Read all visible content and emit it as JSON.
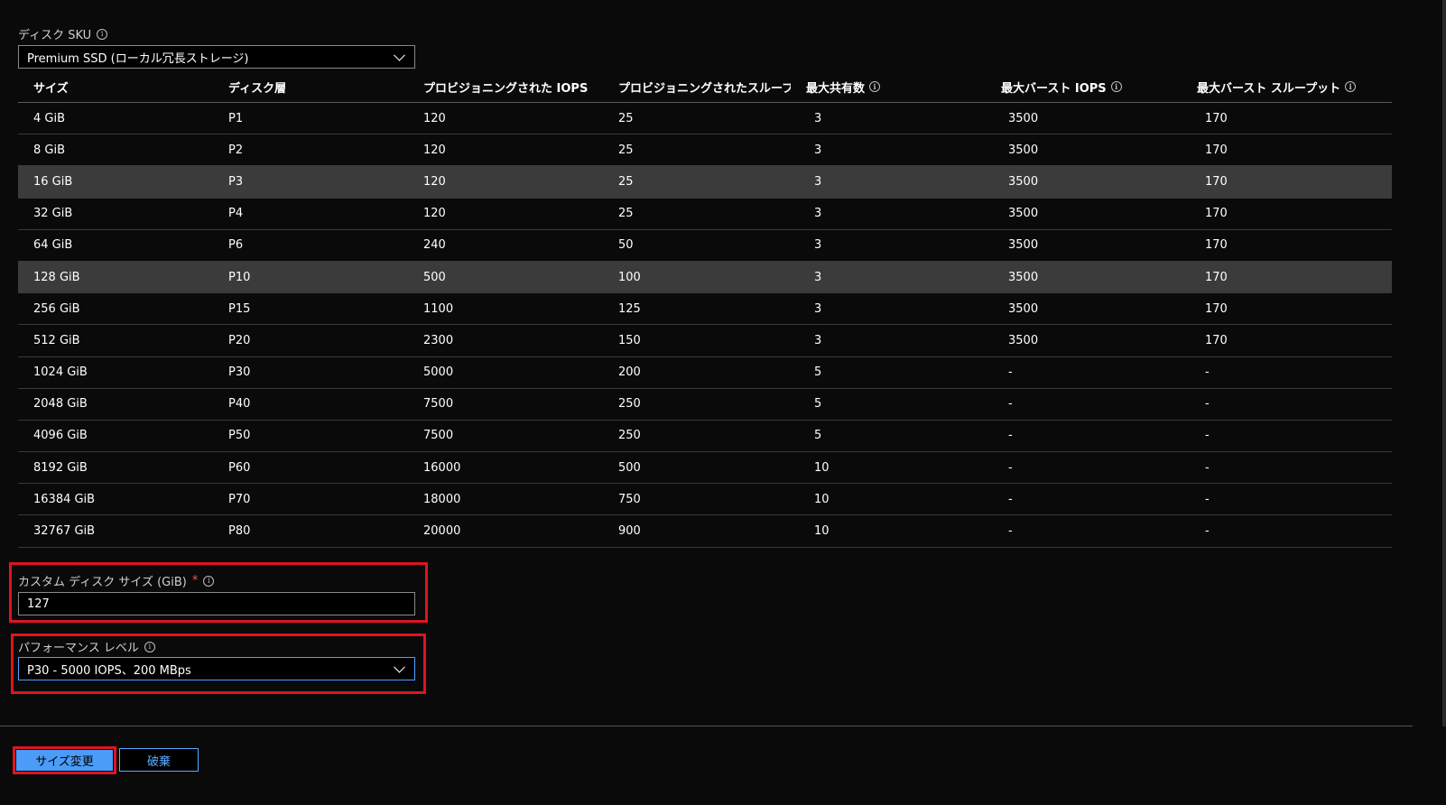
{
  "disk_sku": {
    "label": "ディスク SKU",
    "value": "Premium SSD (ローカル冗長ストレージ)",
    "icon": "info-icon"
  },
  "table": {
    "columns": [
      "サイズ",
      "ディスク層",
      "プロビジョニングされた IOPS",
      "プロビジョニングされたスループ...",
      "最大共有数",
      "最大バースト IOPS",
      "最大バースト スループット"
    ],
    "rows": [
      [
        "4 GiB",
        "P1",
        "120",
        "25",
        "3",
        "3500",
        "170"
      ],
      [
        "8 GiB",
        "P2",
        "120",
        "25",
        "3",
        "3500",
        "170"
      ],
      [
        "16 GiB",
        "P3",
        "120",
        "25",
        "3",
        "3500",
        "170"
      ],
      [
        "32 GiB",
        "P4",
        "120",
        "25",
        "3",
        "3500",
        "170"
      ],
      [
        "64 GiB",
        "P6",
        "240",
        "50",
        "3",
        "3500",
        "170"
      ],
      [
        "128 GiB",
        "P10",
        "500",
        "100",
        "3",
        "3500",
        "170"
      ],
      [
        "256 GiB",
        "P15",
        "1100",
        "125",
        "3",
        "3500",
        "170"
      ],
      [
        "512 GiB",
        "P20",
        "2300",
        "150",
        "3",
        "3500",
        "170"
      ],
      [
        "1024 GiB",
        "P30",
        "5000",
        "200",
        "5",
        "-",
        "-"
      ],
      [
        "2048 GiB",
        "P40",
        "7500",
        "250",
        "5",
        "-",
        "-"
      ],
      [
        "4096 GiB",
        "P50",
        "7500",
        "250",
        "5",
        "-",
        "-"
      ],
      [
        "8192 GiB",
        "P60",
        "16000",
        "500",
        "10",
        "-",
        "-"
      ],
      [
        "16384 GiB",
        "P70",
        "18000",
        "750",
        "10",
        "-",
        "-"
      ],
      [
        "32767 GiB",
        "P80",
        "20000",
        "900",
        "10",
        "-",
        "-"
      ]
    ],
    "highlighted_rows": [
      2,
      5
    ]
  },
  "custom_size": {
    "label": "カスタム ディスク サイズ (GiB)",
    "required_mark": "*",
    "value": "127"
  },
  "performance": {
    "label": "パフォーマンス レベル",
    "value": "P30 - 5000 IOPS、200 MBps"
  },
  "buttons": {
    "resize": "サイズ変更",
    "discard": "破棄"
  },
  "colors": {
    "highlight_border": "#e0141e",
    "primary_button": "#4a9cf8",
    "link_blue": "#5aaaff",
    "selected_row": "#3b3b3b"
  }
}
